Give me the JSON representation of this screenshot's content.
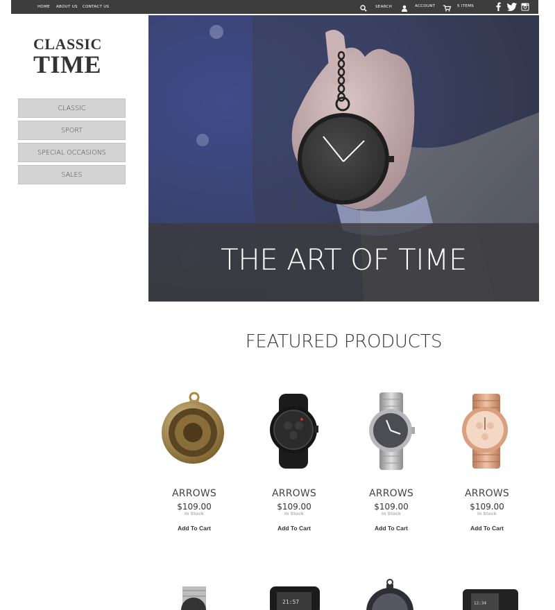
{
  "nav": {
    "home": "HOME",
    "about": "ABOUT US",
    "contact": "CONTACT US",
    "search": "SEARCH",
    "account": "ACCOUNT",
    "cart": "5 ITEMS"
  },
  "logo": {
    "line1": "CLASSIC",
    "line2": "TIME"
  },
  "side_menu": [
    "CLASSIC",
    "SPORT",
    "SPECIAL OCCASIONS",
    "SALES"
  ],
  "hero": {
    "title": "THE ART OF TIME"
  },
  "featured": {
    "title": "FEATURED PRODUCTS",
    "products": [
      {
        "name": "ARROWS",
        "price": "$109.00",
        "stock": "In Stock",
        "cart": "Add To Cart"
      },
      {
        "name": "ARROWS",
        "price": "$109.00",
        "stock": "In Stock",
        "cart": "Add To Cart"
      },
      {
        "name": "ARROWS",
        "price": "$109.00",
        "stock": "In Stock",
        "cart": "Add To Cart"
      },
      {
        "name": "ARROWS",
        "price": "$109.00",
        "stock": "In Stock",
        "cart": "Add To Cart"
      }
    ]
  },
  "colors": {
    "topbar": "#3d3d3d",
    "menu_bg": "#d3d3d4",
    "hero_band": "#3c3a3e"
  },
  "icons": [
    "search-icon",
    "account-icon",
    "cart-icon",
    "facebook-icon",
    "twitter-icon",
    "instagram-icon"
  ]
}
